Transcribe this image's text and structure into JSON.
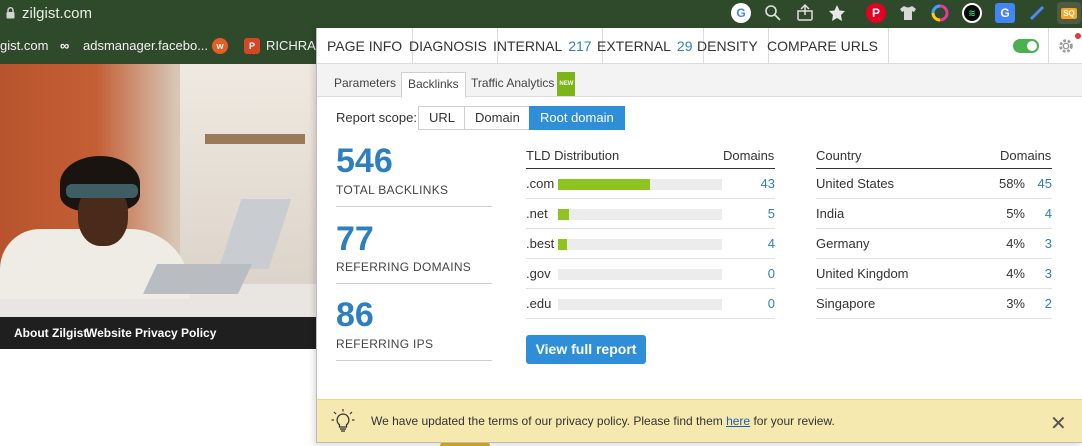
{
  "browser": {
    "url": "zilgist.com",
    "bookmarks": [
      {
        "label": "gist.com"
      },
      {
        "label": "adsmanager.facebo..."
      },
      {
        "label": "RICHRAIN"
      }
    ],
    "bookmark_badges": {
      "w": "w",
      "p": "P"
    },
    "extensions": [
      "google-icon",
      "zoom-icon",
      "share-icon",
      "star-icon",
      "pinterest-icon",
      "shirt-icon",
      "color-ring-icon",
      "seoquake-ext-icon",
      "translate-icon",
      "pen-icon",
      "sq-icon"
    ],
    "sq_label": "SQ"
  },
  "page_footer": {
    "links": [
      "About Zilgist",
      "Website",
      "Privacy Policy"
    ]
  },
  "popup": {
    "nav": [
      {
        "label": "PAGE INFO",
        "count": ""
      },
      {
        "label": "DIAGNOSIS",
        "count": ""
      },
      {
        "label": "INTERNAL",
        "count": "217"
      },
      {
        "label": "EXTERNAL",
        "count": "29"
      },
      {
        "label": "DENSITY",
        "count": ""
      },
      {
        "label": "COMPARE URLS",
        "count": ""
      }
    ],
    "toggle_on": true,
    "subtabs": [
      {
        "label": "Parameters"
      },
      {
        "label": "Backlinks"
      },
      {
        "label": "Traffic Analytics",
        "badge": "NEW"
      }
    ],
    "active_subtab": "Backlinks",
    "scope": {
      "label": "Report scope:",
      "options": [
        "URL",
        "Domain",
        "Root domain"
      ],
      "selected": "Root domain"
    },
    "stats": [
      {
        "value": "546",
        "label": "TOTAL BACKLINKS"
      },
      {
        "value": "77",
        "label": "REFERRING DOMAINS"
      },
      {
        "value": "86",
        "label": "REFERRING IPS"
      }
    ],
    "tld": {
      "header": "TLD Distribution",
      "col": "Domains",
      "rows": [
        {
          "tld": ".com",
          "domains": "43",
          "share": 0.558
        },
        {
          "tld": ".net",
          "domains": "5",
          "share": 0.065
        },
        {
          "tld": ".best",
          "domains": "4",
          "share": 0.052
        },
        {
          "tld": ".gov",
          "domains": "0",
          "share": 0
        },
        {
          "tld": ".edu",
          "domains": "0",
          "share": 0
        }
      ]
    },
    "country": {
      "header": "Country",
      "col": "Domains",
      "rows": [
        {
          "name": "United States",
          "pct": "58%",
          "domains": "45"
        },
        {
          "name": "India",
          "pct": "5%",
          "domains": "4"
        },
        {
          "name": "Germany",
          "pct": "4%",
          "domains": "3"
        },
        {
          "name": "United Kingdom",
          "pct": "4%",
          "domains": "3"
        },
        {
          "name": "Singapore",
          "pct": "3%",
          "domains": "2"
        }
      ]
    },
    "full_report_label": "View full report",
    "notice": {
      "before": "We have updated the terms of our privacy policy. Please find them ",
      "link": "here",
      "after": " for your review.",
      "close": "✕"
    }
  },
  "colors": {
    "accent": "#2e8fd8",
    "link": "#2e7fbf",
    "bar": "#8fc31f",
    "notice_bg": "#f5e9b0",
    "toggle": "#4caf50"
  }
}
